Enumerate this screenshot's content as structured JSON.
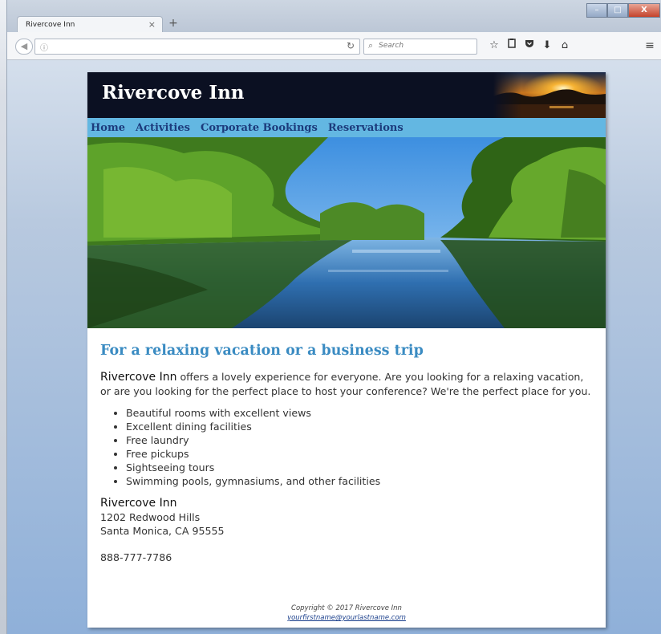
{
  "browser": {
    "tab_title": "Rivercove Inn",
    "tab_close": "×",
    "new_tab": "+",
    "url_info_icon": "info-circle-icon",
    "search_placeholder": "Search",
    "win_min": "–",
    "win_max": "□",
    "win_close": "X"
  },
  "site": {
    "title": "Rivercove Inn",
    "nav": [
      "Home",
      "Activities",
      "Corporate Bookings",
      "Reservations"
    ],
    "headline": "For a relaxing vacation or a business trip",
    "intro_brand": "Rivercove Inn",
    "intro_text": " offers a lovely experience for everyone. Are you looking for a relaxing vacation, or are you looking for the perfect place to host your conference? We're the perfect place for you.",
    "features": [
      "Beautiful rooms with excellent views",
      "Excellent dining facilities",
      "Free laundry",
      "Free pickups",
      "Sightseeing tours",
      "Swimming pools, gymnasiums, and other facilities"
    ],
    "address": {
      "name": "Rivercove Inn",
      "street": "1202 Redwood Hills",
      "city": "Santa Monica, CA 95555"
    },
    "phone": "888-777-7786",
    "footer": {
      "copyright": "Copyright © 2017 Rivercove Inn",
      "email": "yourfirstname@yourlastname.com"
    }
  },
  "colors": {
    "header_bg": "#0b1022",
    "nav_bg": "#63b7e2",
    "nav_link": "#1c3b7c",
    "headline": "#3a8bc2"
  }
}
